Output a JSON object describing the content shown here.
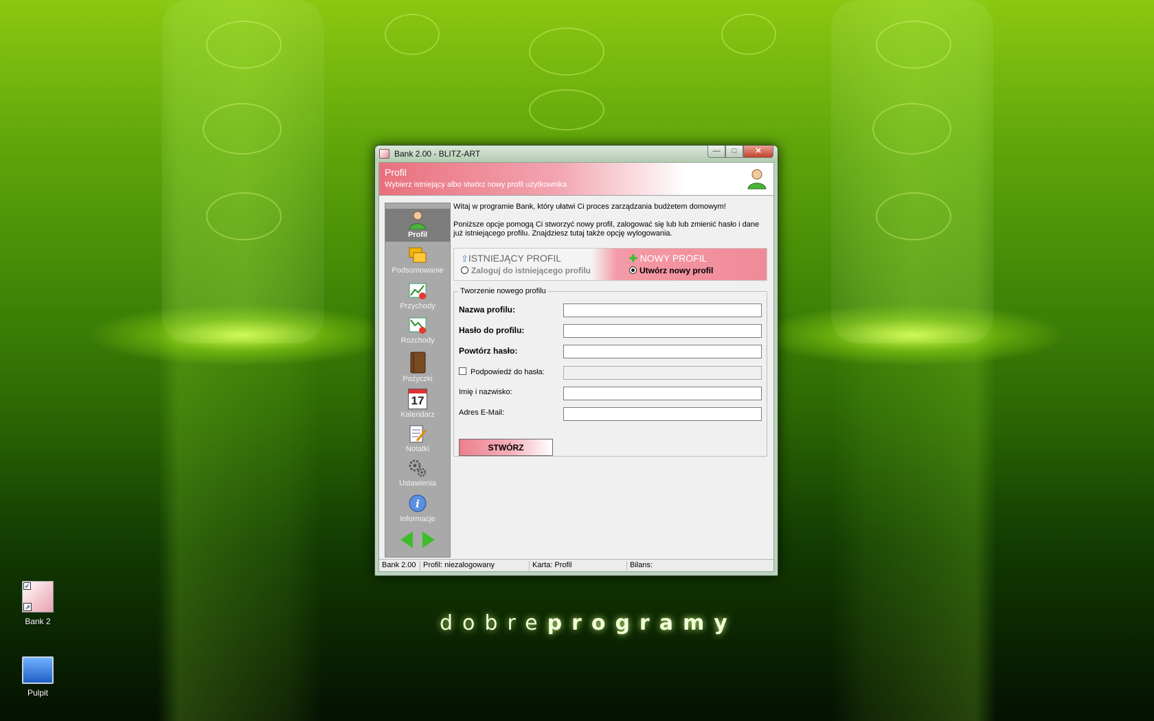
{
  "desktop": {
    "icons": [
      {
        "label": "Bank 2"
      },
      {
        "label": "Pulpit"
      }
    ],
    "watermark_light": "dobre",
    "watermark_bold": "programy"
  },
  "window": {
    "title": "Bank 2.00 - BLITZ-ART",
    "controls": {
      "minimize": "—",
      "maximize": "□",
      "close": "✕"
    }
  },
  "header": {
    "title": "Profil",
    "subtitle": "Wybierz istniejący albo stwórz nowy profil użytkownika"
  },
  "sidebar": {
    "items": [
      {
        "label": "Profil",
        "icon": "user-icon",
        "active": true
      },
      {
        "label": "Podsumowanie",
        "icon": "summary-icon"
      },
      {
        "label": "Przychody",
        "icon": "income-chart-icon"
      },
      {
        "label": "Rozchody",
        "icon": "expense-chart-icon"
      },
      {
        "label": "Pożyczki",
        "icon": "book-icon"
      },
      {
        "label": "Kalendarz",
        "icon": "calendar-icon",
        "calendar_day": "17"
      },
      {
        "label": "Notatki",
        "icon": "notes-icon"
      },
      {
        "label": "Ustawienia",
        "icon": "gears-icon"
      },
      {
        "label": "Informacje",
        "icon": "info-icon"
      }
    ]
  },
  "main": {
    "welcome": "Witaj w programie Bank, który ułatwi Ci proces zarządzania budżetem domowym!",
    "description": "Poniższe opcje pomogą Ci stworzyć nowy profil, zalogować się lub lub zmienić hasło i dane już istniejącego profilu. Znajdziesz tutaj także opcję wylogowania.",
    "mode_existing": {
      "title": "ISTNIEJĄCY PROFIL",
      "option": "Zaloguj do istniejącego profilu"
    },
    "mode_new": {
      "title": "NOWY PROFIL",
      "option": "Utwórz nowy profil",
      "selected": true
    },
    "form": {
      "legend": "Tworzenie nowego profilu",
      "profile_name_label": "Nazwa profilu:",
      "profile_name_value": "",
      "password_label": "Hasło do profilu:",
      "password_value": "",
      "repeat_password_label": "Powtórz hasło:",
      "repeat_password_value": "",
      "hint_label": "Podpowiedź do hasła:",
      "hint_value": "",
      "fullname_label": "Imię i nazwisko:",
      "fullname_value": "",
      "email_label": "Adres E-Mail:",
      "email_value": "",
      "create_button": "STWÓRZ"
    }
  },
  "statusbar": {
    "app": "Bank 2.00",
    "profile": "Profil: niezalogowany",
    "card": "Karta: Profil",
    "balance": "Bilans:"
  },
  "colors": {
    "accent_pink": "#ec7f8d",
    "nav_gray": "#a9a9a9",
    "nav_active": "#7c7c7c",
    "arrow_green": "#3cbd2b"
  }
}
